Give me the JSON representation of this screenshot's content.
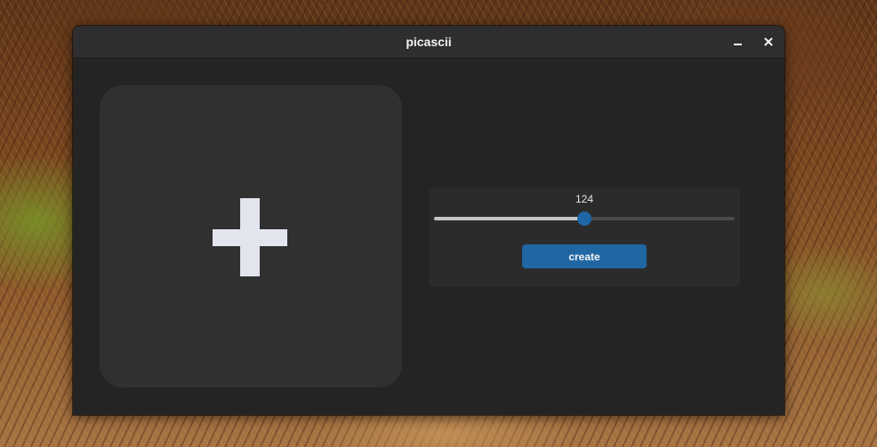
{
  "window": {
    "title": "picascii",
    "controls": [
      "minimize-icon",
      "close-icon"
    ]
  },
  "image_drop": {
    "icon": "plus-icon"
  },
  "settings": {
    "slider": {
      "value_label": "124",
      "level": 0.5
    },
    "create_label": "create"
  },
  "colors": {
    "accent": "#2066a3",
    "window_bg": "#242424",
    "titlebar_bg": "#2e2e2e",
    "drop_area_bg": "#303030",
    "plus_color": "#e2e4ee"
  }
}
